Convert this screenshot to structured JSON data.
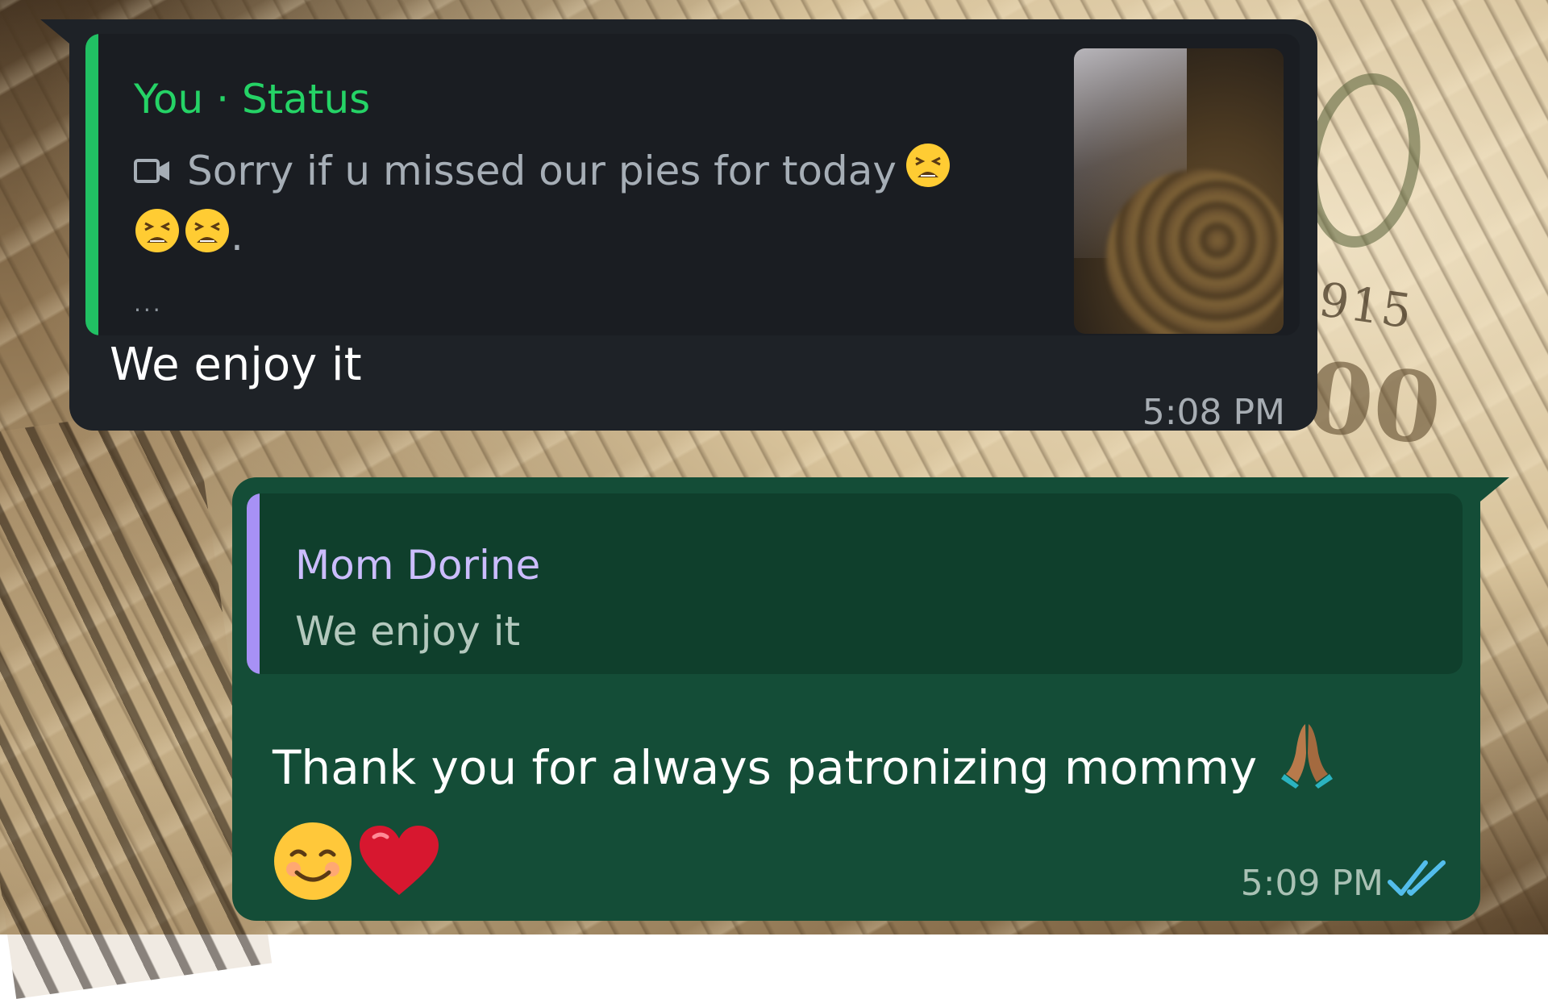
{
  "incoming_message": {
    "quoted_status": {
      "sender": "You · Status",
      "media_icon": "video-camera-icon",
      "caption": "Sorry if u missed our pies for today",
      "caption_emojis": [
        "tired-face",
        "tired-face",
        "tired-face"
      ],
      "caption_trailing": ".",
      "ellipsis": "...",
      "thumbnail": "pies-photo-thumbnail"
    },
    "text": "We enjoy it",
    "time": "5:08 PM"
  },
  "outgoing_message": {
    "quoted_reply": {
      "sender": "Mom Dorine",
      "text": "We enjoy it"
    },
    "text": "Thank you for always patronizing mommy",
    "emojis": [
      "folded-hands",
      "smiling-face",
      "red-heart"
    ],
    "time": "5:09 PM",
    "read_receipt": "double-check-read-icon"
  },
  "colors": {
    "incoming_bubble": "#1e2227",
    "outgoing_bubble": "#144d37",
    "status_accent": "#25d366",
    "reply_accent": "#a791f5",
    "read_tick": "#53bdeb"
  }
}
